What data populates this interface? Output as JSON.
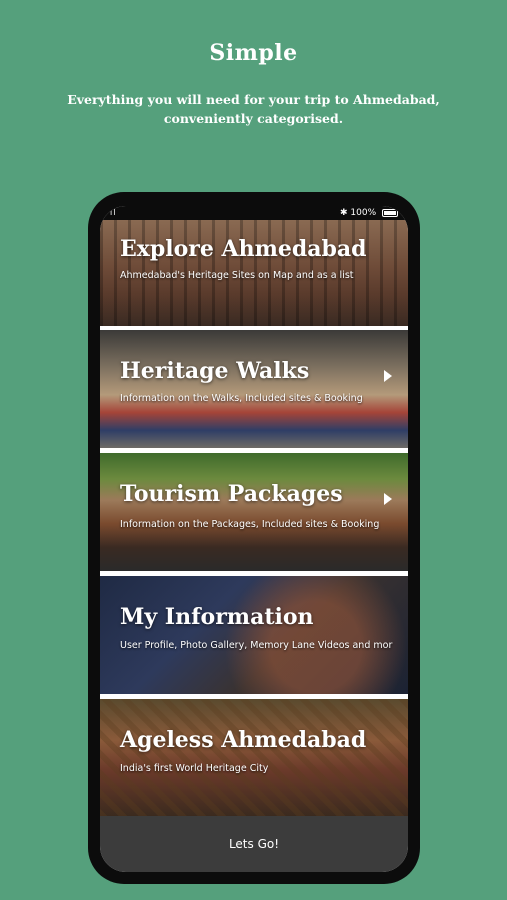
{
  "promo": {
    "title": "Simple",
    "subtitle": "Everything you will need for your trip to Ahmedabad, conveniently categorised."
  },
  "status_bar": {
    "signal": "ıl",
    "battery": "100%",
    "bluetooth_icon": "bluetooth-icon"
  },
  "cards": [
    {
      "title": "Explore Ahmedabad",
      "description": "Ahmedabad's Heritage Sites on Map and as a list",
      "has_chevron": false
    },
    {
      "title": "Heritage Walks",
      "description": "Information on the Walks, Included sites & Booking",
      "has_chevron": true
    },
    {
      "title": "Tourism Packages",
      "description": "Information on the Packages, Included sites & Booking",
      "has_chevron": true
    },
    {
      "title": "My Information",
      "description": "User Profile, Photo Gallery, Memory Lane Videos and mor",
      "has_chevron": false
    },
    {
      "title": "Ageless Ahmedabad",
      "description": "India's first World Heritage City",
      "has_chevron": false
    }
  ],
  "cta": {
    "label": "Lets Go!"
  },
  "colors": {
    "background": "#55a07c",
    "phone": "#0c0c0c",
    "cta": "#3c3c3c"
  }
}
